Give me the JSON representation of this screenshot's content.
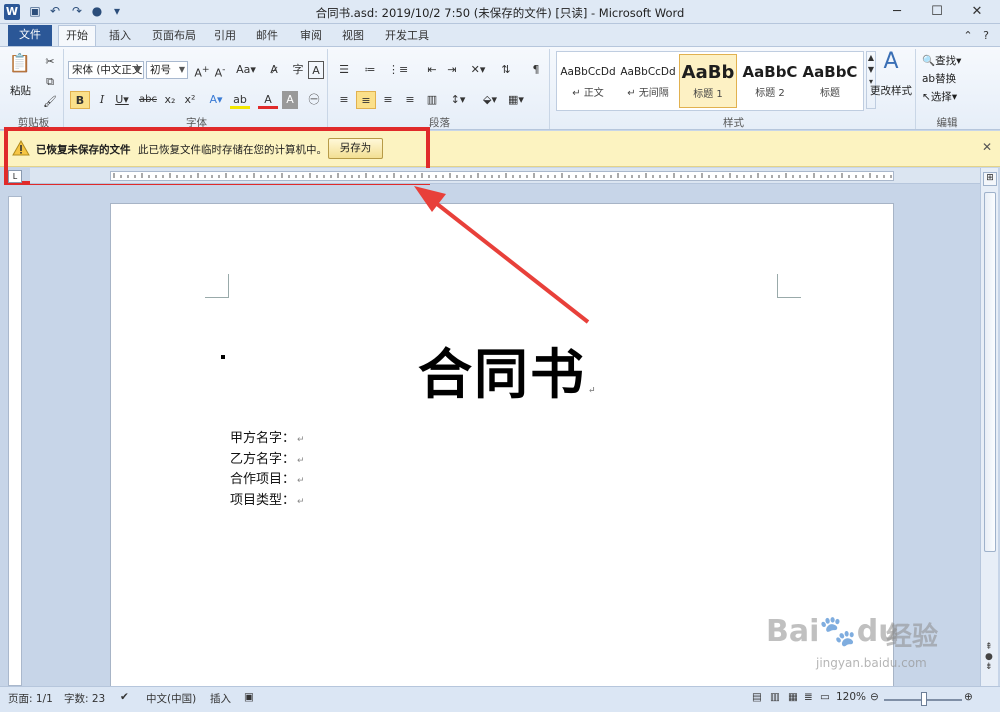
{
  "window": {
    "title": "合同书.asd: 2019/10/2 7:50 (未保存的文件) [只读] - Microsoft Word",
    "app_icon": "W"
  },
  "tabs": [
    "文件",
    "开始",
    "插入",
    "页面布局",
    "引用",
    "邮件",
    "审阅",
    "视图",
    "开发工具"
  ],
  "ribbon": {
    "clipboard": {
      "paste": "粘贴",
      "label": "剪贴板"
    },
    "font": {
      "name": "宋体 (中文正文",
      "size": "初号",
      "label": "字体"
    },
    "paragraph": {
      "label": "段落"
    },
    "styles": {
      "label": "样式",
      "items": [
        {
          "sample": "AaBbCcDd",
          "name": "↵ 正文"
        },
        {
          "sample": "AaBbCcDd",
          "name": "↵ 无间隔"
        },
        {
          "sample": "AaBb",
          "name": "标题 1"
        },
        {
          "sample": "AaBbC",
          "name": "标题 2"
        },
        {
          "sample": "AaBbC",
          "name": "标题"
        }
      ],
      "change": "更改样式"
    },
    "editing": {
      "find": "查找",
      "replace": "替换",
      "select": "选择",
      "label": "编辑"
    }
  },
  "infobar": {
    "bold": "已恢复未保存的文件",
    "message": "此已恢复文件临时存储在您的计算机中。",
    "button": "另存为"
  },
  "document": {
    "title": "合同书",
    "lines": [
      "甲方名字：",
      "乙方名字：",
      "合作项目：",
      "项目类型："
    ]
  },
  "status": {
    "page": "页面: 1/1",
    "words": "字数: 23",
    "language": "中文(中国)",
    "mode": "插入",
    "zoom": "120%"
  },
  "watermark": {
    "brand": "Bai",
    "brand2": "du",
    "cn": "经验",
    "url": "jingyan.baidu.com"
  }
}
